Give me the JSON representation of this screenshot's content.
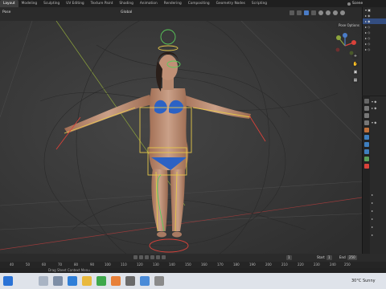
{
  "menubar": {
    "tabs": [
      "Layout",
      "Modeling",
      "Sculpting",
      "UV Editing",
      "Texture Paint",
      "Shading",
      "Animation",
      "Rendering",
      "Compositing",
      "Geometry Nodes",
      "Scripting"
    ],
    "active_tab": "Layout",
    "scene_label": "Scene"
  },
  "viewport_header": {
    "mode": "Pose",
    "orientation": "Global"
  },
  "viewport": {
    "pose_options": "Pose Options"
  },
  "timeline": {
    "start_label": "Start",
    "start_value": "1",
    "end_label": "End",
    "end_value": "250",
    "current_frame": "1",
    "ruler": [
      "40",
      "50",
      "60",
      "70",
      "80",
      "90",
      "100",
      "110",
      "120",
      "130",
      "140",
      "150",
      "160",
      "170",
      "180",
      "190",
      "200",
      "210",
      "220",
      "230",
      "240",
      "250"
    ]
  },
  "status": {
    "hint": "Drag Sheet Context Menu"
  },
  "taskbar": {
    "weather": "30°C Sunny"
  },
  "colors": {
    "accent": "#4a7cc7",
    "bone": "#e6c84a",
    "bone_selected": "#5acb5a",
    "rig_red": "#d9423a"
  }
}
